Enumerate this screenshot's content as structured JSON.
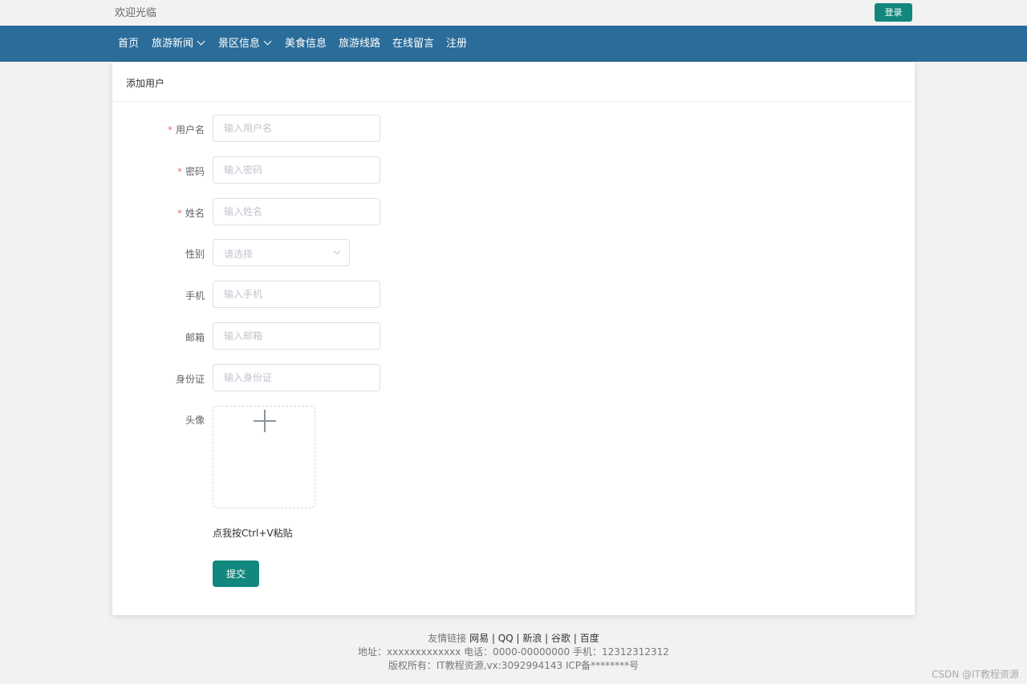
{
  "topbar": {
    "welcome": "欢迎光临",
    "login_label": "登录"
  },
  "nav": {
    "items": [
      {
        "label": "首页",
        "has_dropdown": false
      },
      {
        "label": "旅游新闻",
        "has_dropdown": true
      },
      {
        "label": "景区信息",
        "has_dropdown": true
      },
      {
        "label": "美食信息",
        "has_dropdown": false
      },
      {
        "label": "旅游线路",
        "has_dropdown": false
      },
      {
        "label": "在线留言",
        "has_dropdown": false
      },
      {
        "label": "注册",
        "has_dropdown": false
      }
    ]
  },
  "form": {
    "title": "添加用户",
    "required_mark": "*",
    "fields": {
      "username": {
        "label": "用户名",
        "placeholder": "输入用户名",
        "required": true
      },
      "password": {
        "label": "密码",
        "placeholder": "输入密码",
        "required": true
      },
      "name": {
        "label": "姓名",
        "placeholder": "输入姓名",
        "required": true
      },
      "gender": {
        "label": "性别",
        "placeholder": "请选择"
      },
      "phone": {
        "label": "手机",
        "placeholder": "输入手机"
      },
      "email": {
        "label": "邮箱",
        "placeholder": "输入邮箱"
      },
      "idcard": {
        "label": "身份证",
        "placeholder": "输入身份证"
      },
      "avatar": {
        "label": "头像"
      }
    },
    "paste_tip": "点我按Ctrl+V粘贴",
    "submit_label": "提交"
  },
  "footer": {
    "links_label": "友情链接",
    "links": "网易 | QQ | 新浪 | 谷歌 | 百度",
    "contact": "地址：xxxxxxxxxxxxx 电话：0000-00000000 手机：12312312312",
    "copyright": "版权所有：IT教程资源,vx:3092994143 ICP备********号"
  },
  "watermark": "CSDN @IT教程资源",
  "colors": {
    "nav_bg": "#2b6d9a",
    "accent": "#12877e",
    "required": "#f56c6c"
  },
  "icons": {
    "dropdown": "chevron-down-icon",
    "upload": "plus-icon"
  }
}
